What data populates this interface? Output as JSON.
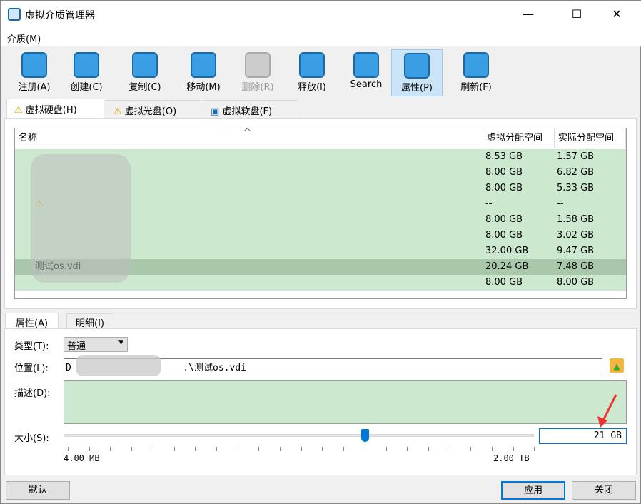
{
  "window": {
    "title": "虚拟介质管理器",
    "minimize": "—",
    "maximize": "☐",
    "close": "✕"
  },
  "menu": {
    "media": "介质(M)"
  },
  "toolbar": [
    {
      "label": "注册(A)",
      "icon": "hdd-add-icon",
      "enabled": true
    },
    {
      "label": "创建(C)",
      "icon": "hdd-create-icon",
      "enabled": true
    },
    {
      "label": "复制(C)",
      "icon": "hdd-copy-icon",
      "enabled": true
    },
    {
      "label": "移动(M)",
      "icon": "hdd-move-icon",
      "enabled": true
    },
    {
      "label": "删除(R)",
      "icon": "hdd-remove-icon",
      "enabled": false
    },
    {
      "label": "释放(l)",
      "icon": "hdd-release-icon",
      "enabled": true
    },
    {
      "label": "Search",
      "icon": "hdd-search-icon",
      "enabled": true
    },
    {
      "label": "属性(P)",
      "icon": "hdd-properties-icon",
      "enabled": true,
      "active": true
    },
    {
      "label": "刷新(F)",
      "icon": "refresh-icon",
      "enabled": true
    }
  ],
  "media_tabs": [
    {
      "label": "虚拟硬盘(H)",
      "selected": true
    },
    {
      "label": "虚拟光盘(O)"
    },
    {
      "label": "虚拟软盘(F)"
    }
  ],
  "table": {
    "columns": [
      "名称",
      "虚拟分配空间",
      "实际分配空间"
    ],
    "rows": [
      {
        "name": "",
        "virtual": "8.53 GB",
        "actual": "1.57 GB"
      },
      {
        "name": "",
        "virtual": "8.00 GB",
        "actual": "6.82 GB"
      },
      {
        "name": "",
        "virtual": "8.00 GB",
        "actual": "5.33 GB"
      },
      {
        "name": "",
        "virtual": "--",
        "actual": "--",
        "warning": true
      },
      {
        "name": "",
        "virtual": "8.00 GB",
        "actual": "1.58 GB"
      },
      {
        "name": "",
        "virtual": "8.00 GB",
        "actual": "3.02 GB"
      },
      {
        "name": "",
        "virtual": "32.00 GB",
        "actual": "9.47 GB"
      },
      {
        "name": "测试os.vdi",
        "virtual": "20.24 GB",
        "actual": "7.48 GB",
        "selected": true
      },
      {
        "name": "",
        "virtual": "8.00 GB",
        "actual": "8.00 GB"
      }
    ]
  },
  "detail_tabs": [
    {
      "label": "属性(A)",
      "selected": true
    },
    {
      "label": "明细(I)"
    }
  ],
  "props": {
    "type_label": "类型(T):",
    "type_value": "普通",
    "location_label": "位置(L):",
    "location_value": "D                    .\\测试os.vdi",
    "description_label": "描述(D):",
    "description_value": "",
    "size_label": "大小(S):",
    "size_value": "21 GB",
    "size_min": "4.00 MB",
    "size_max": "2.00 TB",
    "slider_fraction": 0.64
  },
  "buttons": {
    "reset": "默认",
    "apply": "应用",
    "close": "关闭"
  },
  "colors": {
    "row_bg": "#cce8cf",
    "row_selected": "#a9c8ab",
    "accent": "#0078d7"
  }
}
